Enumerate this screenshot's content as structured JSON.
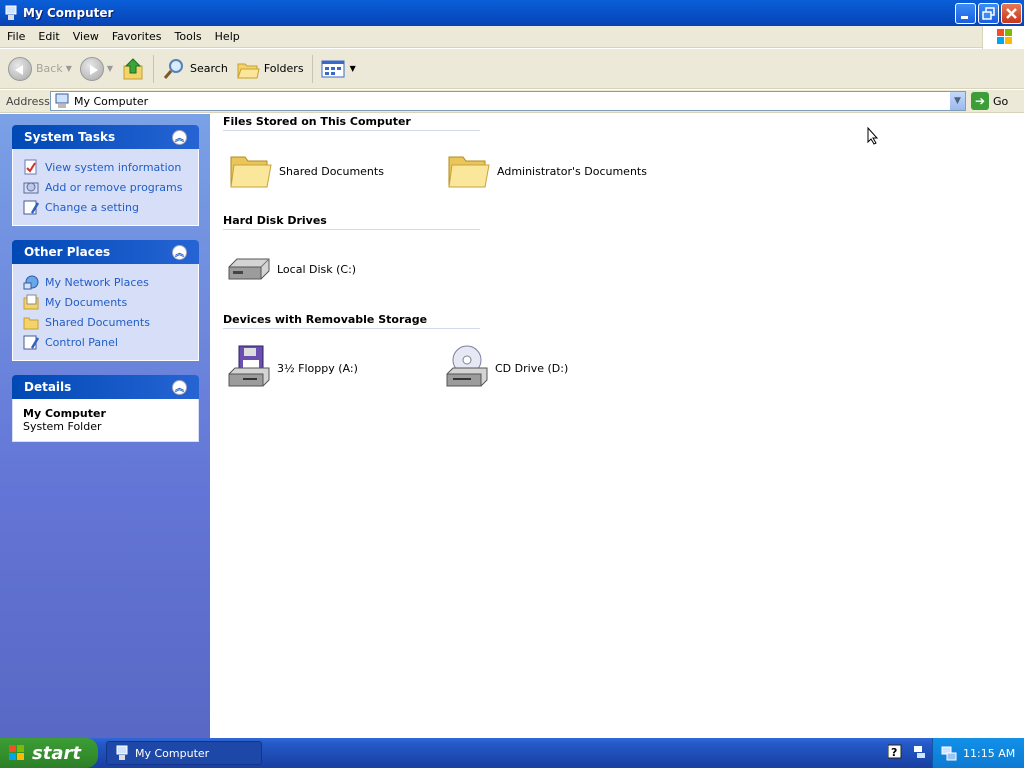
{
  "window": {
    "title": "My Computer",
    "minimize": "minimize-icon",
    "maximize": "restore-icon",
    "close": "close-icon"
  },
  "menu": [
    "File",
    "Edit",
    "View",
    "Favorites",
    "Tools",
    "Help"
  ],
  "toolbar": {
    "back": "Back",
    "search": "Search",
    "folders": "Folders"
  },
  "address": {
    "label": "Address",
    "value": "My Computer",
    "go": "Go"
  },
  "sidebar": {
    "system_tasks": {
      "title": "System Tasks",
      "items": [
        "View system information",
        "Add or remove programs",
        "Change a setting"
      ]
    },
    "other_places": {
      "title": "Other Places",
      "items": [
        "My Network Places",
        "My Documents",
        "Shared Documents",
        "Control Panel"
      ]
    },
    "details": {
      "title": "Details",
      "name": "My Computer",
      "type": "System Folder"
    }
  },
  "main": {
    "groups": [
      {
        "title": "Files Stored on This Computer",
        "items": [
          "Shared Documents",
          "Administrator's Documents"
        ]
      },
      {
        "title": "Hard Disk Drives",
        "items": [
          "Local Disk (C:)"
        ]
      },
      {
        "title": "Devices with Removable Storage",
        "items": [
          "3½ Floppy (A:)",
          "CD Drive (D:)"
        ]
      }
    ]
  },
  "taskbar": {
    "start": "start",
    "task": "My Computer",
    "clock": "11:15 AM"
  },
  "colors": {
    "titlebar": "#0a5fd8",
    "sidebar": "#6375d6",
    "link": "#215dc6",
    "start": "#3c9c36"
  }
}
